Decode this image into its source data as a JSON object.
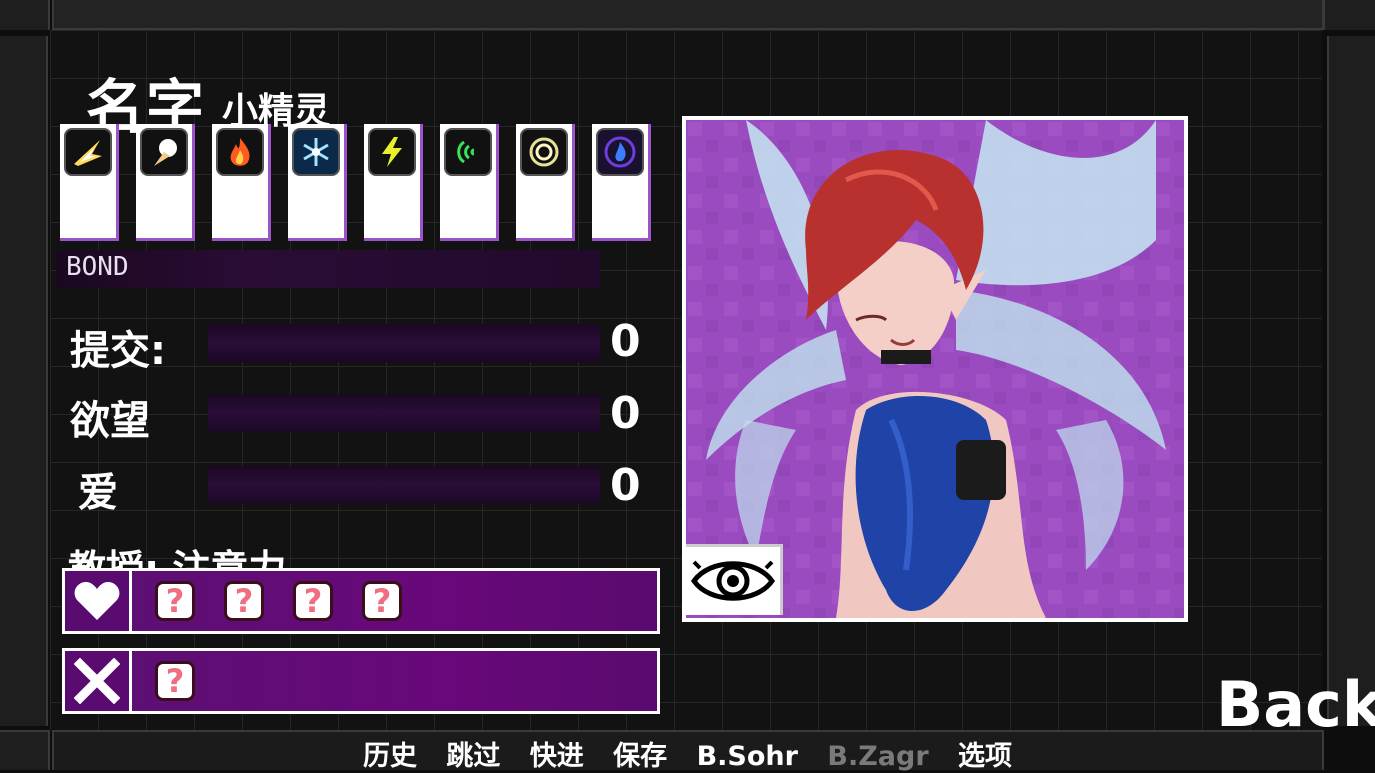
{
  "character": {
    "name_label": "名字",
    "name": "小精灵"
  },
  "element_cards": [
    {
      "icon": "light-burst-icon"
    },
    {
      "icon": "holy-fist-icon"
    },
    {
      "icon": "fire-icon"
    },
    {
      "icon": "ice-icon"
    },
    {
      "icon": "lightning-icon"
    },
    {
      "icon": "wind-icon"
    },
    {
      "icon": "earth-ring-icon"
    },
    {
      "icon": "dark-flame-icon"
    }
  ],
  "bond": {
    "label": "BOND"
  },
  "stats": [
    {
      "label": "提交:",
      "value": "0"
    },
    {
      "label": "欲望",
      "value": "0"
    },
    {
      "label": "爱",
      "value": "0"
    }
  ],
  "teach": {
    "label": "教授: 注意力"
  },
  "likes_row": {
    "slots": [
      "?",
      "?",
      "?",
      "?"
    ]
  },
  "dislikes_row": {
    "slots": [
      "?"
    ]
  },
  "back_label": "Back",
  "quick_menu": {
    "history": "历史",
    "skip": "跳过",
    "auto": "快进",
    "save": "保存",
    "bsohr": "B.Sohr",
    "bzagr": "B.Zagr",
    "options": "选项"
  },
  "colors": {
    "accent_purple": "#5a0b70",
    "card_border": "#9b55c9",
    "portrait_bg": "#9a4bbf"
  }
}
